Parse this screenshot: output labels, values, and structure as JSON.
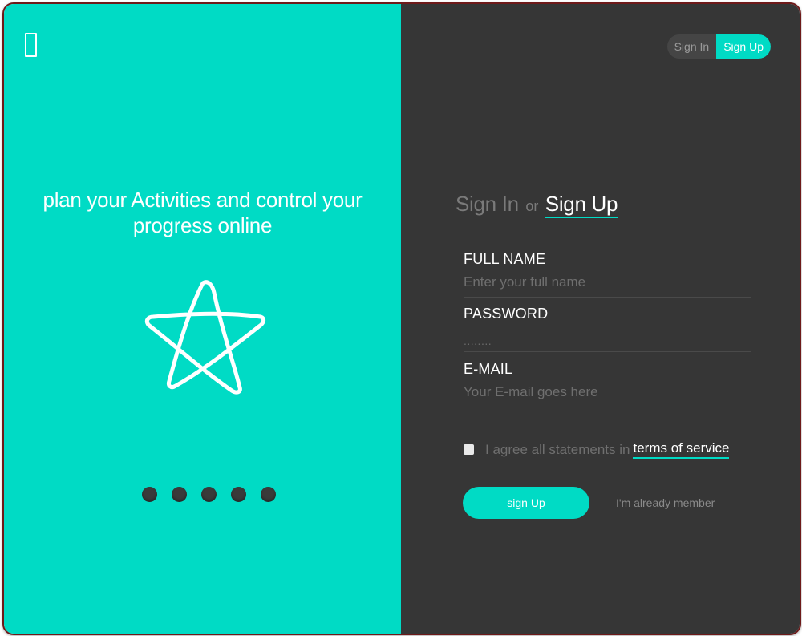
{
  "left_panel": {
    "logo_icon": "rectangle-logo-icon",
    "headline": "plan your Activities and control your progress online",
    "illustration_icon": "star-icon",
    "carousel_dot_count": 5,
    "background_color": "#00dbc5"
  },
  "right_panel": {
    "background_color": "#363636",
    "toggle": {
      "sign_in_label": "Sign In",
      "sign_up_label": "Sign Up",
      "active": "Sign Up"
    },
    "title": {
      "sign_in": "Sign In",
      "or": "or",
      "sign_up": "Sign Up"
    },
    "fields": {
      "full_name": {
        "label": "FULL NAME",
        "placeholder": "Enter your full name",
        "value": ""
      },
      "password": {
        "label": "PASSWORD",
        "placeholder": "........",
        "value": ""
      },
      "email": {
        "label": "E-MAIL",
        "placeholder": "Your E-mail goes here",
        "value": ""
      }
    },
    "agree": {
      "text": "I agree all statements in",
      "terms_link": "terms of service",
      "checked": false
    },
    "submit_label": "sign Up",
    "member_link": "I'm already member"
  },
  "colors": {
    "accent": "#00dbc5",
    "dark": "#363636",
    "frame_border": "#6e1a1a"
  }
}
